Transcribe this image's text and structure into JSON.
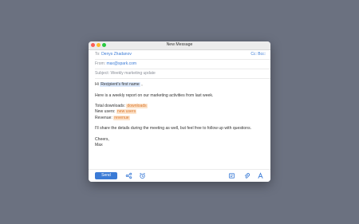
{
  "window": {
    "title": "New Message"
  },
  "compose": {
    "to_label": "To:",
    "to_value": "Denys Zhadanov",
    "cc_bcc": "Cc: Bcc:",
    "from_label": "From:",
    "from_value": "max@spark.com",
    "subject_label": "Subject:",
    "subject_value": "Weekly marketing update"
  },
  "body": {
    "greeting_prefix": "Hi",
    "recipient_token": "Recipient's first name",
    "greeting_suffix": ",",
    "line1": "Here is a weekly report on our marketing activities from last week.",
    "downloads_label": "Total downloads:",
    "downloads_token": "downloads",
    "users_label": "New users:",
    "users_token": "new users",
    "revenue_label": "Revenue:",
    "revenue_token": "revenue",
    "line2": "I'll share the details during the meeting as well, but feel free to follow up with questions.",
    "signoff": "Cheers,",
    "signature": "Max"
  },
  "toolbar": {
    "send_label": "Send",
    "icons": [
      "share-icon",
      "alarm-clock-icon",
      "template-icon",
      "attachment-icon",
      "text-format-icon"
    ]
  },
  "colors": {
    "accent": "#3b7bd6",
    "desktop": "#6b7180",
    "token_blue_bg": "#dbe8fb",
    "token_orange_bg": "#fde4cc",
    "token_orange_text": "#d9772d"
  }
}
